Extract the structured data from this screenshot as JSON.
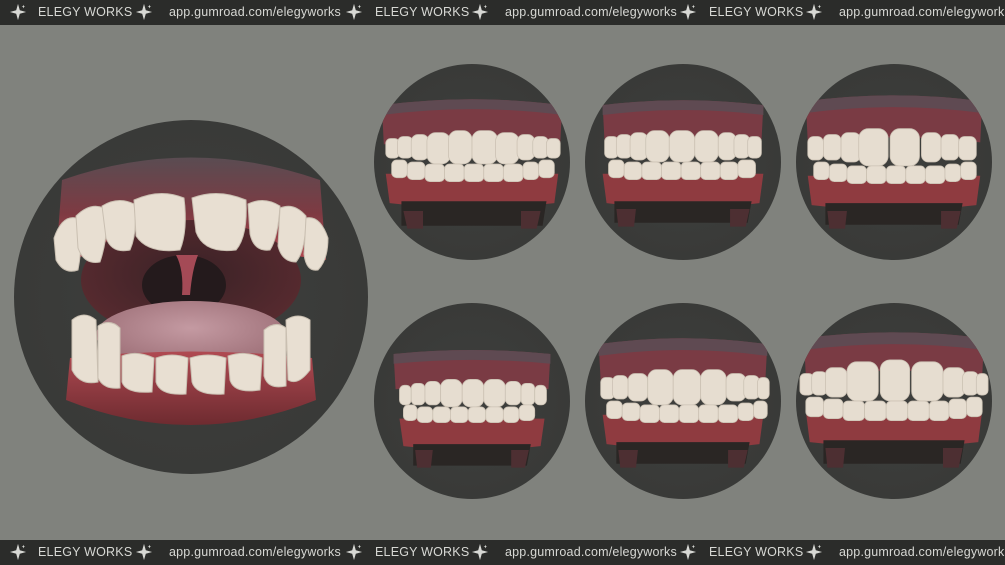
{
  "watermark": {
    "brand": "ELEGY WORKS",
    "url": "app.gumroad.com/elegyworks",
    "icon": "sparkle-star-icon"
  },
  "colors": {
    "background": "#80827d",
    "banner": "#2b2c2a",
    "circle": "#3b3c3a",
    "gum": "#8e3b3e",
    "tooth": "#e6ddd0",
    "tongue": "#b98a91"
  },
  "renders": [
    {
      "view": "open-mouth"
    },
    {
      "view": "closed-front"
    },
    {
      "view": "closed-front"
    },
    {
      "view": "closed-front"
    },
    {
      "view": "closed-front"
    },
    {
      "view": "closed-front"
    },
    {
      "view": "closed-front"
    }
  ]
}
